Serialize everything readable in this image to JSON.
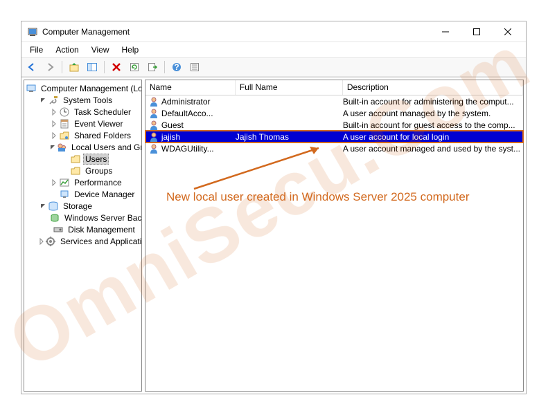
{
  "window": {
    "title": "Computer Management"
  },
  "menu": {
    "items": [
      "File",
      "Action",
      "View",
      "Help"
    ]
  },
  "tree": {
    "root": "Computer Management (Local)",
    "nodes": [
      {
        "label": "System Tools",
        "depth": 1,
        "expanded": true,
        "icon": "tools"
      },
      {
        "label": "Task Scheduler",
        "depth": 2,
        "expanded": false,
        "icon": "clock"
      },
      {
        "label": "Event Viewer",
        "depth": 2,
        "expanded": false,
        "icon": "event"
      },
      {
        "label": "Shared Folders",
        "depth": 2,
        "expanded": false,
        "icon": "folder-share"
      },
      {
        "label": "Local Users and Groups",
        "depth": 2,
        "expanded": true,
        "icon": "users-group"
      },
      {
        "label": "Users",
        "depth": 3,
        "expanded": null,
        "icon": "folder",
        "selected": true
      },
      {
        "label": "Groups",
        "depth": 3,
        "expanded": null,
        "icon": "folder"
      },
      {
        "label": "Performance",
        "depth": 2,
        "expanded": false,
        "icon": "perf"
      },
      {
        "label": "Device Manager",
        "depth": 2,
        "expanded": null,
        "icon": "device"
      },
      {
        "label": "Storage",
        "depth": 1,
        "expanded": true,
        "icon": "storage"
      },
      {
        "label": "Windows Server Backup",
        "depth": 2,
        "expanded": null,
        "icon": "backup"
      },
      {
        "label": "Disk Management",
        "depth": 2,
        "expanded": null,
        "icon": "disk"
      },
      {
        "label": "Services and Applications",
        "depth": 1,
        "expanded": false,
        "icon": "services"
      }
    ]
  },
  "list": {
    "columns": [
      "Name",
      "Full Name",
      "Description"
    ],
    "rows": [
      {
        "name": "Administrator",
        "full": "",
        "desc": "Built-in account for administering the comput..."
      },
      {
        "name": "DefaultAcco...",
        "full": "",
        "desc": "A user account managed by the system."
      },
      {
        "name": "Guest",
        "full": "",
        "desc": "Built-in account for guest access to the comp..."
      },
      {
        "name": "jajish",
        "full": "Jajish Thomas",
        "desc": "A user account for local login",
        "selected": true
      },
      {
        "name": "WDAGUtility...",
        "full": "",
        "desc": "A user account managed and used by the syst..."
      }
    ]
  },
  "annotation": {
    "text": "New local user created in Windows Server 2025 computer"
  },
  "watermark": "OmniSecu.Com"
}
